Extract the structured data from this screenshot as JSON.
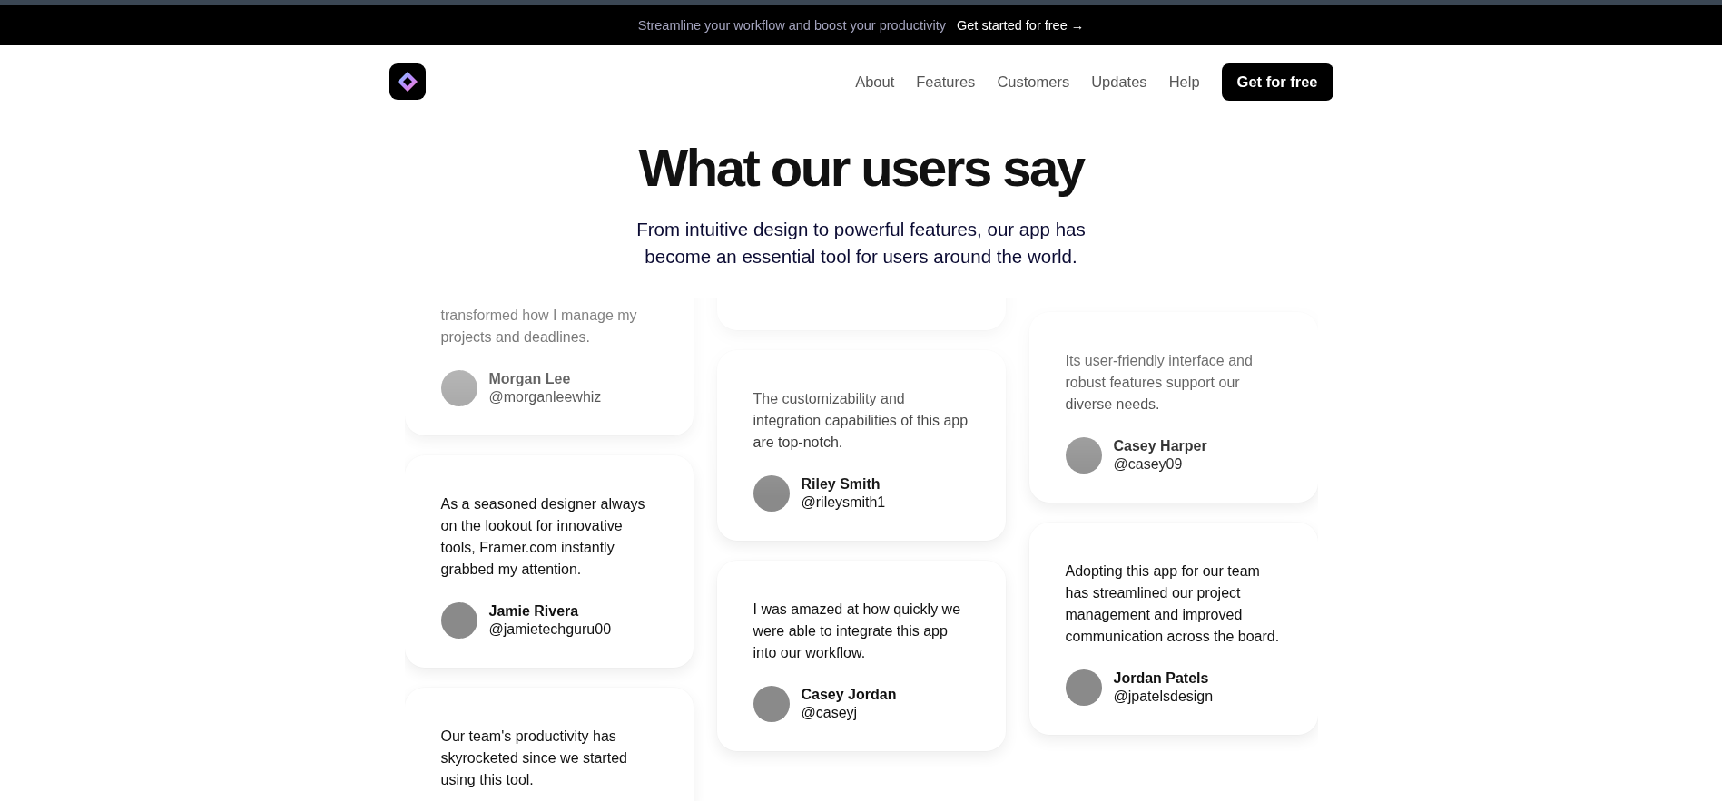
{
  "announcement": {
    "text": "Streamline your workflow and boost your productivity",
    "link": "Get started for free",
    "link_icon": "→"
  },
  "nav": {
    "links": [
      "About",
      "Features",
      "Customers",
      "Updates",
      "Help"
    ],
    "cta": "Get for free"
  },
  "hero": {
    "title": "What our users say",
    "subtitle": "From intuitive design to powerful features, our app has become an essential tool for users around the world."
  },
  "columns": [
    {
      "cards": [
        {
          "quote": "transformed how I manage my projects and deadlines.",
          "name": "Morgan Lee",
          "handle": "@morganleewhiz"
        },
        {
          "quote": "As a seasoned designer always on the lookout for innovative tools, Framer.com instantly grabbed my attention.",
          "name": "Jamie Rivera",
          "handle": "@jamietechguru00"
        },
        {
          "quote": "Our team's productivity has skyrocketed since we started using this tool."
        }
      ]
    },
    {
      "cards": [
        {
          "kind": "cut"
        },
        {
          "quote": "The customizability and integration capabilities of this app are top-notch.",
          "name": "Riley Smith",
          "handle": "@rileysmith1"
        },
        {
          "quote": "I was amazed at how quickly we were able to integrate this app into our workflow.",
          "name": "Casey Jordan",
          "handle": "@caseyj"
        }
      ]
    },
    {
      "cards": [
        {
          "quote": "Its user-friendly interface and robust features support our diverse needs.",
          "name": "Casey Harper",
          "handle": "@casey09"
        },
        {
          "quote": "Adopting this app for our team has streamlined our project management and improved communication across the board.",
          "name": "Jordan Patels",
          "handle": "@jpatelsdesign"
        }
      ]
    }
  ]
}
